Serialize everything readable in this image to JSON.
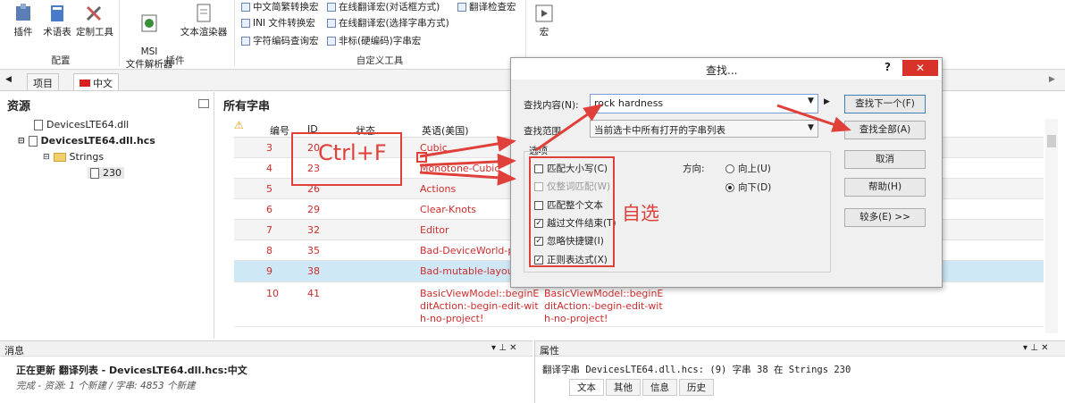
{
  "ribbon": {
    "buttons": [
      {
        "label": "插件"
      },
      {
        "label": "术语表"
      },
      {
        "label": "定制工具"
      },
      {
        "label": "MSI\n文件解析器"
      },
      {
        "label": "文本渲染器"
      },
      {
        "label": "宏"
      }
    ],
    "groups": [
      "配置",
      "插件",
      "自定义工具"
    ],
    "custom_items": [
      "中文简繁转换宏",
      "INI 文件转换宏",
      "字符编码查询宏",
      "在线翻译宏(对话框方式)",
      "在线翻译宏(选择字串方式)",
      "非标(硬编码)字串宏",
      "翻译检查宏"
    ]
  },
  "tabs": [
    "项目",
    "中文"
  ],
  "left_panel": {
    "title": "资源",
    "tree": [
      "DevicesLTE64.dll",
      "DevicesLTE64.dll.hcs",
      "Strings",
      "230"
    ]
  },
  "grid": {
    "title": "所有字串",
    "headers": [
      "编号",
      "ID",
      "状态",
      "英语(美国)"
    ],
    "rows": [
      {
        "num": "3",
        "id": "20",
        "text": "Cubic"
      },
      {
        "num": "4",
        "id": "23",
        "text": "Monotone-Cubic"
      },
      {
        "num": "5",
        "id": "26",
        "text": "Actions"
      },
      {
        "num": "6",
        "id": "29",
        "text": "Clear-Knots"
      },
      {
        "num": "7",
        "id": "32",
        "text": "Editor"
      },
      {
        "num": "8",
        "id": "35",
        "text": "Bad-DeviceWorld-po"
      },
      {
        "num": "9",
        "id": "38",
        "text": "Bad-mutable-layout"
      },
      {
        "num": "10",
        "id": "41",
        "text": "BasicViewModel::beginEditAction:-begin-edit-with-no-project!",
        "trans": "BasicViewModel::beginEditAction:-begin-edit-with-no-project!"
      }
    ]
  },
  "dialog": {
    "title": "查找...",
    "help": "?",
    "close": "✕",
    "find_label": "查找内容(N):",
    "find_value": "rock hardness",
    "scope_label": "查找范围",
    "scope_value": "当前选卡中所有打开的字串列表",
    "options_label": "选项",
    "options": [
      {
        "label": "匹配大小写(C)",
        "checked": false
      },
      {
        "label": "仅整词匹配(W)",
        "checked": false
      },
      {
        "label": "匹配整个文本",
        "checked": false
      },
      {
        "label": "越过文件结束(T)",
        "checked": true
      },
      {
        "label": "忽略快捷键(I)",
        "checked": true
      },
      {
        "label": "正则表达式(X)",
        "checked": true
      }
    ],
    "direction_label": "方向:",
    "up": "向上(U)",
    "down": "向下(D)",
    "buttons": [
      "查找下一个(F)",
      "查找全部(A)",
      "取消",
      "帮助(H)",
      "较多(E) >>"
    ]
  },
  "annotations": {
    "shortcut": "Ctrl+F",
    "self_choose": "自选"
  },
  "message_panel": {
    "title": "消息",
    "line1": "正在更新 翻译列表 - DevicesLTE64.dll.hcs:中文",
    "line2": "完成 - 资源: 1 个新建 / 字串: 4853 个新建"
  },
  "props_panel": {
    "title": "属性",
    "line1": "翻译字串 DevicesLTE64.dll.hcs: (9) 字串 38 在 Strings 230",
    "tabs": [
      "文本",
      "其他",
      "信息",
      "历史"
    ]
  },
  "colors": {
    "accent_red": "#e0403a",
    "row_red": "#cf2d2d",
    "selected_row": "#cfe8f6"
  }
}
